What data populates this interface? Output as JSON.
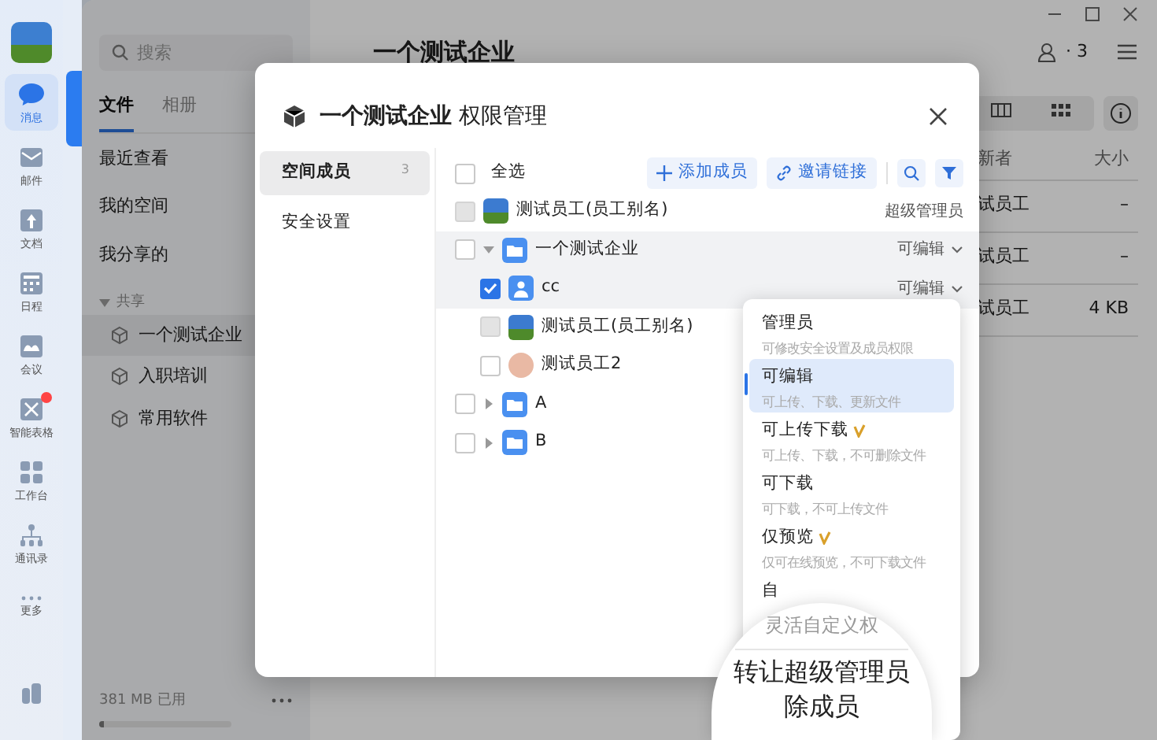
{
  "rail": {
    "items": [
      {
        "label": "消息",
        "selected": true,
        "badge": false
      },
      {
        "label": "邮件",
        "selected": false,
        "badge": false
      },
      {
        "label": "文档",
        "selected": false,
        "badge": false
      },
      {
        "label": "日程",
        "selected": false,
        "badge": false
      },
      {
        "label": "会议",
        "selected": false,
        "badge": false
      },
      {
        "label": "智能表格",
        "selected": false,
        "badge": true
      },
      {
        "label": "工作台",
        "selected": false,
        "badge": false
      },
      {
        "label": "通讯录",
        "selected": false,
        "badge": false
      },
      {
        "label": "更多",
        "selected": false,
        "badge": false
      }
    ]
  },
  "sidebar": {
    "search": {
      "placeholder": "搜索"
    },
    "tabs": [
      {
        "label": "文件",
        "selected": true
      },
      {
        "label": "相册",
        "selected": false
      }
    ],
    "nav": [
      "最近查看",
      "我的空间",
      "我分享的"
    ],
    "section": {
      "label": "共享",
      "expanded": true,
      "items": [
        {
          "label": "一个测试企业",
          "selected": true
        },
        {
          "label": "入职培训",
          "selected": false
        },
        {
          "label": "常用软件",
          "selected": false
        }
      ]
    },
    "storage": {
      "label": "381 MB 已用",
      "level": 0.03
    }
  },
  "main": {
    "title": "一个测试企业",
    "members_count": "· 3",
    "table": {
      "columns": [
        "新者",
        "大小"
      ],
      "rows": [
        [
          "试员工",
          "–"
        ],
        [
          "试员工",
          "–"
        ],
        [
          "试员工",
          "4 KB"
        ]
      ]
    }
  },
  "dialog": {
    "title": "一个测试企业",
    "subtitle": "权限管理",
    "tabs": [
      {
        "label": "空间成员",
        "count": "3",
        "selected": true
      },
      {
        "label": "安全设置",
        "selected": false
      }
    ],
    "select_all": {
      "label": "全选",
      "checked": false
    },
    "actions": [
      {
        "label": "添加成员",
        "kind": "add"
      },
      {
        "label": "邀请链接",
        "kind": "invite"
      }
    ],
    "members": [
      {
        "name": "测试员工(员工别名)",
        "kind": "photo",
        "checked": false,
        "disabled": true,
        "highlighted": false,
        "role": {
          "label": "超级管理员",
          "dropdown": false
        }
      },
      {
        "name": "一个测试企业",
        "kind": "folder",
        "checked": false,
        "disabled": false,
        "highlighted": true,
        "expanded": true,
        "role": {
          "label": "可编辑",
          "dropdown": true
        },
        "children": [
          {
            "name": "cc",
            "kind": "user",
            "checked": true,
            "disabled": false,
            "highlighted": true,
            "role": {
              "label": "可编辑",
              "dropdown": true
            }
          },
          {
            "name": "测试员工(员工别名)",
            "kind": "photo",
            "checked": false,
            "disabled": true,
            "highlighted": false
          },
          {
            "name": "测试员工2",
            "kind": "face",
            "checked": false,
            "disabled": false,
            "highlighted": false
          }
        ]
      },
      {
        "name": "A",
        "kind": "folder",
        "checked": false,
        "disabled": false,
        "highlighted": false,
        "expanded": false
      },
      {
        "name": "B",
        "kind": "folder",
        "checked": false,
        "disabled": false,
        "highlighted": false,
        "expanded": false
      }
    ]
  },
  "role_menu": {
    "options": [
      {
        "title": "管理员",
        "description": "可修改安全设置及成员权限",
        "premium": false,
        "selected": false
      },
      {
        "title": "可编辑",
        "description": "可上传、下载、更新文件",
        "premium": false,
        "selected": true
      },
      {
        "title": "可上传下载",
        "description": "可上传、下载，不可删除文件",
        "premium": true,
        "selected": false
      },
      {
        "title": "可下载",
        "description": "可下载，不可上传文件",
        "premium": false,
        "selected": false
      },
      {
        "title": "仅预览",
        "description": "仅可在线预览，不可下载文件",
        "premium": true,
        "selected": false
      },
      {
        "title": "自",
        "premium": false,
        "selected": false
      }
    ],
    "lens": [
      {
        "kind": "hint",
        "text": "灵活自定义权"
      },
      {
        "kind": "action",
        "text": "转让超级管理员"
      },
      {
        "kind": "action",
        "text": "除成员"
      }
    ]
  }
}
